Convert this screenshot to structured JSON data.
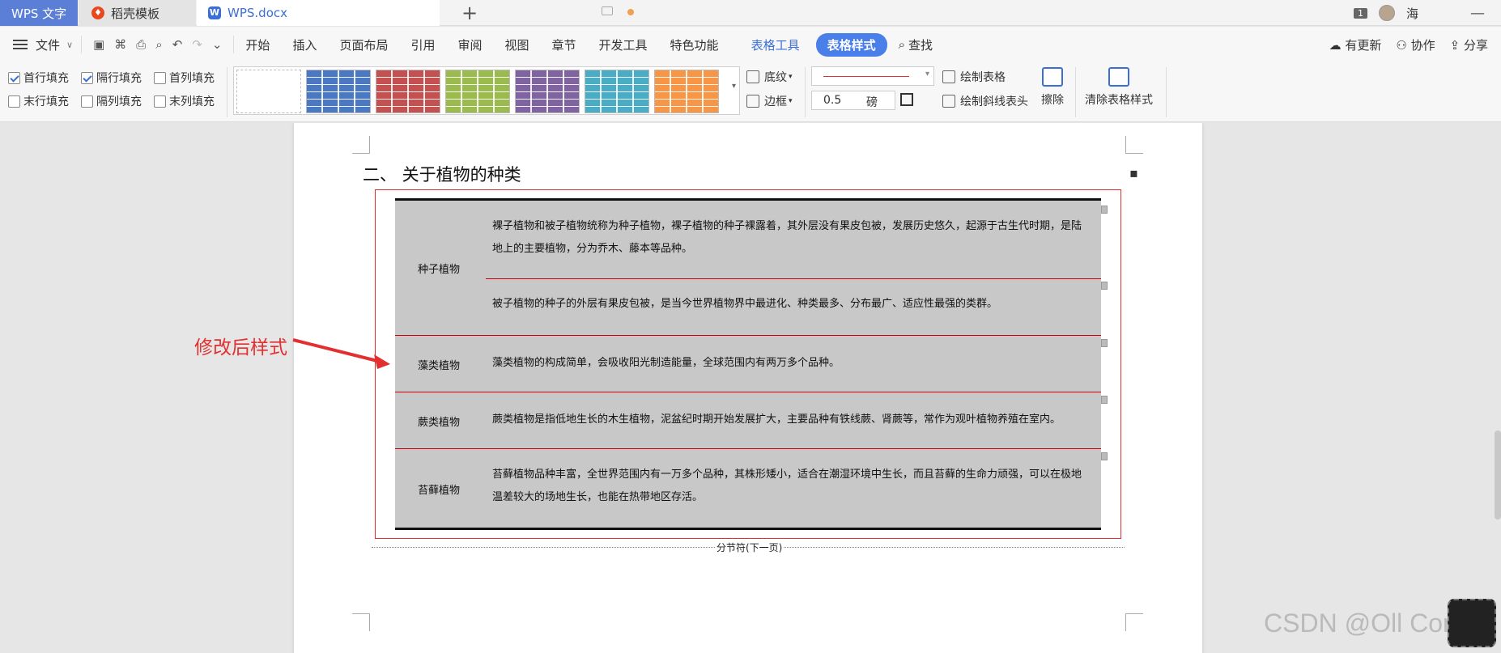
{
  "titlebar": {
    "app_tab": "WPS 文字",
    "template_tab": "稻壳模板",
    "doc_tab": "WPS.docx",
    "window_count": "1",
    "user_name": "海"
  },
  "menubar": {
    "file": "文件",
    "items": [
      "开始",
      "插入",
      "页面布局",
      "引用",
      "审阅",
      "视图",
      "章节",
      "开发工具",
      "特色功能"
    ],
    "table_tool": "表格工具",
    "table_style": "表格样式",
    "find": "查找",
    "right": [
      "有更新",
      "协作",
      "分享"
    ]
  },
  "ribbon": {
    "checkboxes": [
      {
        "label": "首行填充",
        "checked": true
      },
      {
        "label": "隔行填充",
        "checked": true
      },
      {
        "label": "首列填充",
        "checked": false
      },
      {
        "label": "末行填充",
        "checked": false
      },
      {
        "label": "隔列填充",
        "checked": false
      },
      {
        "label": "末列填充",
        "checked": false
      }
    ],
    "swatch_colors": [
      "#ffffff",
      "#4a78c2",
      "#c55050",
      "#9bbb4f",
      "#8064a2",
      "#4bacc6",
      "#f79646"
    ],
    "shading": "底纹",
    "border": "边框",
    "line_width": "0.5",
    "line_width_unit": "磅",
    "draw_table": "绘制表格",
    "draw_diagonal": "绘制斜线表头",
    "erase": "擦除",
    "clear_style": "清除表格样式"
  },
  "document": {
    "heading": "二、 关于植物的种类",
    "rows": [
      {
        "label": "种子植物",
        "texts": [
          "裸子植物和被子植物统称为种子植物，裸子植物的种子裸露着，其外层没有果皮包被，发展历史悠久，起源于古生代时期，是陆地上的主要植物，分为乔木、藤本等品种。",
          "被子植物的种子的外层有果皮包被，是当今世界植物界中最进化、种类最多、分布最广、适应性最强的类群。"
        ]
      },
      {
        "label": "藻类植物",
        "texts": [
          "藻类植物的构成简单，会吸收阳光制造能量，全球范围内有两万多个品种。"
        ]
      },
      {
        "label": "蕨类植物",
        "texts": [
          "蕨类植物是指低地生长的木生植物，泥盆纪时期开始发展扩大，主要品种有铁线蕨、肾蕨等，常作为观叶植物养殖在室内。"
        ]
      },
      {
        "label": "苔藓植物",
        "texts": [
          "苔藓植物品种丰富，全世界范围内有一万多个品种，其株形矮小，适合在潮湿环境中生长，而且苔藓的生命力顽强，可以在极地温差较大的场地生长，也能在热带地区存活。"
        ]
      }
    ],
    "section_break": "分节符(下一页)"
  },
  "annotation": {
    "label": "修改后样式",
    "color": "#e23030"
  },
  "watermark": "CSDN @Oll Correct"
}
